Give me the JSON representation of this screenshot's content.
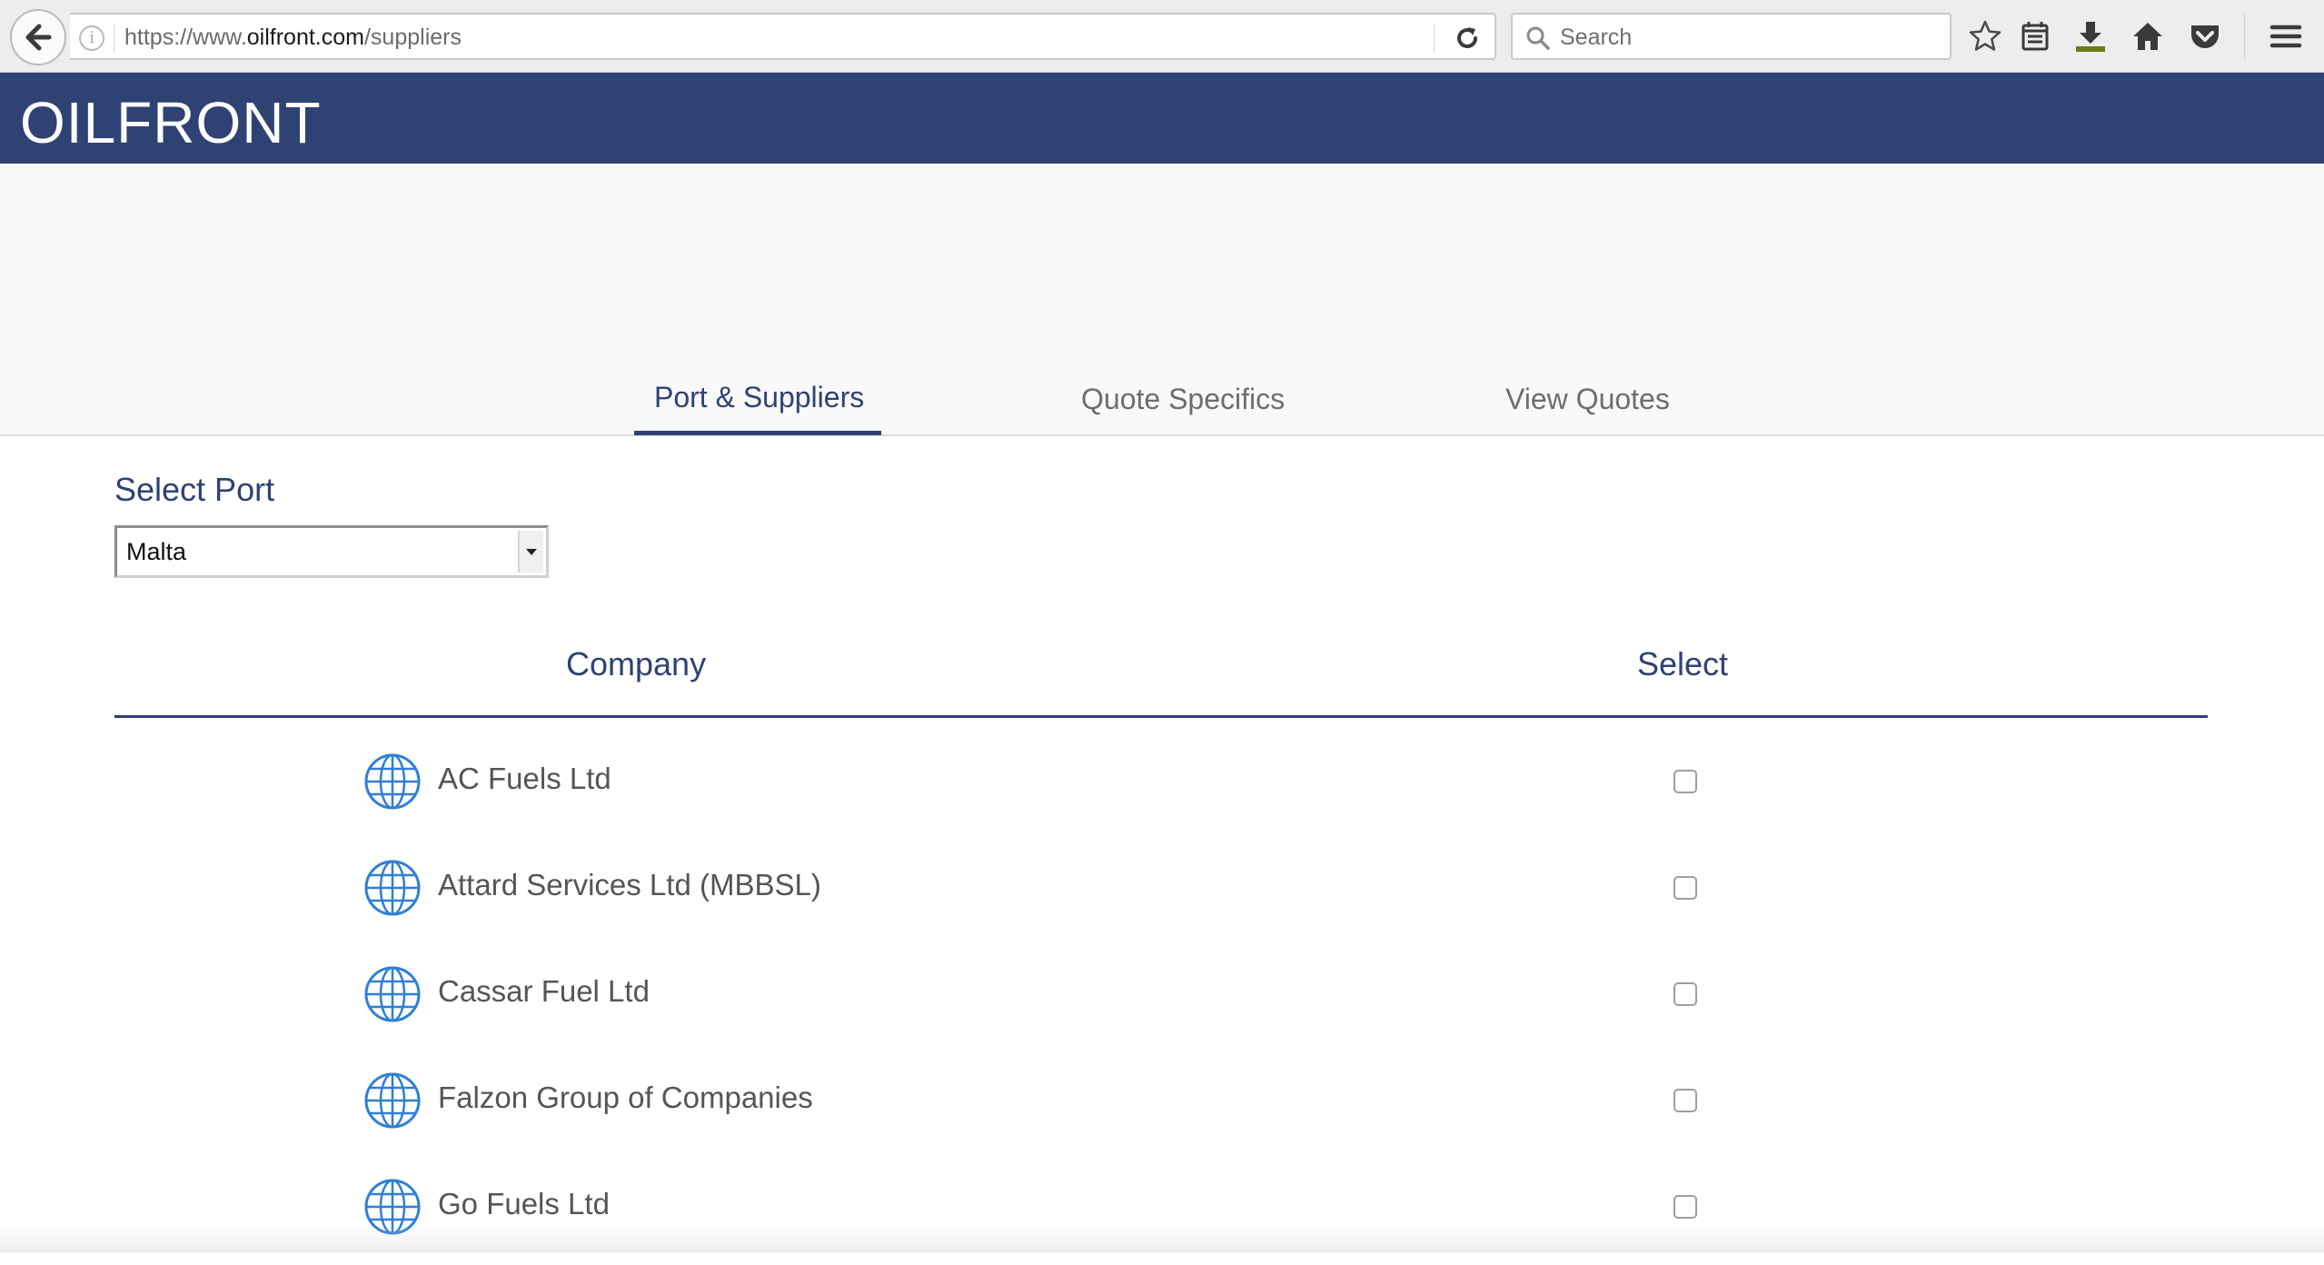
{
  "browser": {
    "url_prefix": "https://www.",
    "url_domain": "oilfront.com",
    "url_path": "/suppliers",
    "search_placeholder": "Search"
  },
  "site": {
    "logo": "OILFRONT",
    "brand_color": "#2e4273"
  },
  "tabs": [
    {
      "label": "Port & Suppliers",
      "active": true
    },
    {
      "label": "Quote Specifics",
      "active": false
    },
    {
      "label": "View Quotes",
      "active": false
    }
  ],
  "port": {
    "label": "Select Port",
    "selected": "Malta"
  },
  "table": {
    "headers": {
      "company": "Company",
      "select": "Select"
    },
    "rows": [
      {
        "company": "AC Fuels Ltd",
        "icon": "globe-icon",
        "selected": false
      },
      {
        "company": "Attard Services Ltd (MBBSL)",
        "icon": "globe-icon",
        "selected": false
      },
      {
        "company": "Cassar Fuel Ltd",
        "icon": "globe-icon",
        "selected": false
      },
      {
        "company": "Falzon Group of Companies",
        "icon": "globe-icon",
        "selected": false
      },
      {
        "company": "Go Fuels Ltd",
        "icon": "globe-icon",
        "selected": false
      }
    ]
  }
}
